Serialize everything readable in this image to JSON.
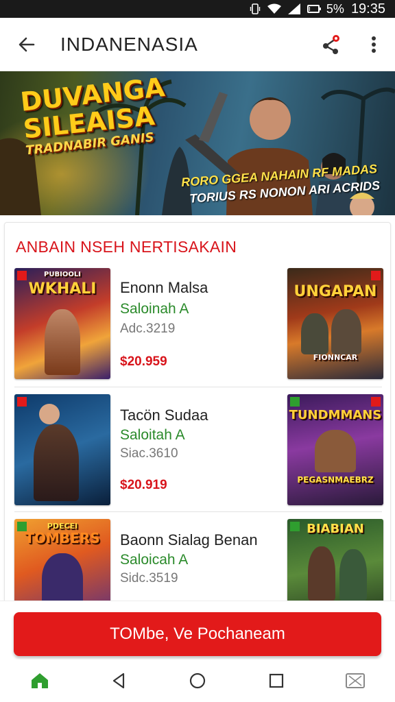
{
  "status_bar": {
    "battery_text": "5%",
    "battery_level": 0.05,
    "time": "19:35",
    "icons": [
      "vibrate-icon",
      "wifi-icon",
      "signal-icon",
      "battery-icon"
    ]
  },
  "app_bar": {
    "title": "INDANENASIA",
    "icons": [
      "back-arrow-icon",
      "share-icon",
      "more-vert-icon"
    ],
    "share_badge_color": "#e21a1a"
  },
  "banner": {
    "headline_line1": "DUVANGA",
    "headline_line2": "SILEAISA",
    "headline_line3": "TRADNABIR GANIS",
    "tagline_line1": "RORO GGEA NAHAIN RF MADAS",
    "tagline_line2": "TORIUS RS NONON ARI ACRIDS"
  },
  "section": {
    "title": "ANBAIN NSEH NERTISAKAIN",
    "title_color": "#d8141b"
  },
  "items": [
    {
      "thumb_title": "WKHALI",
      "thumb_top_text": "PUBIOOLI",
      "name": "Enonn Malsa",
      "subtitle": "Saloinah A",
      "meta": "Adc.3219",
      "price": "$20.959",
      "right_thumb_title": "UNGAPAN",
      "right_thumb_bottom": "FIONNCAR"
    },
    {
      "thumb_title": "",
      "thumb_top_text": "",
      "name": "Tacön Sudaa",
      "subtitle": "Saloitah A",
      "meta": "Siac.3610",
      "price": "$20.919",
      "right_thumb_title": "TUNDMMANS",
      "right_thumb_bottom": "PEGASNMAEBRZ"
    },
    {
      "thumb_title": "TOMBERS",
      "thumb_top_text": "PDECEI",
      "name": "Baonn Sialag Benan",
      "subtitle": "Saloicah A",
      "meta": "Sidc.3519",
      "price": "",
      "right_thumb_title": "BIABIAN",
      "right_thumb_bottom": ""
    }
  ],
  "cta": {
    "label": "TOMbe, Ve Pochaneam",
    "color": "#e21a1a"
  },
  "nav_bar": {
    "icons": [
      "home-icon",
      "back-triangle-icon",
      "home-circle-icon",
      "recents-square-icon",
      "screenshot-icon"
    ],
    "home_color": "#2f9e2f"
  }
}
